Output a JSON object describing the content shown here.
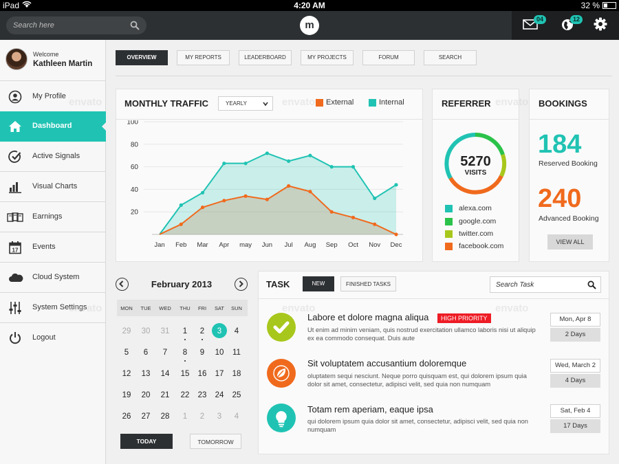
{
  "status_bar": {
    "device": "iPad",
    "time": "4:20 AM",
    "battery": "32 %"
  },
  "top_bar": {
    "search_placeholder": "Search here",
    "logo_letter": "m",
    "mail_badge": "04",
    "globe_badge": "12"
  },
  "sidebar": {
    "welcome": "Welcome",
    "user_name": "Kathleen Martin",
    "items": [
      {
        "label": "My Profile",
        "icon": "user-icon"
      },
      {
        "label": "Dashboard",
        "icon": "home-icon",
        "active": true
      },
      {
        "label": "Active Signals",
        "icon": "check-circle-icon"
      },
      {
        "label": "Visual Charts",
        "icon": "bar-chart-icon"
      },
      {
        "label": "Earnings",
        "icon": "money-icon"
      },
      {
        "label": "Events",
        "icon": "calendar-icon"
      },
      {
        "label": "Cloud System",
        "icon": "cloud-icon"
      },
      {
        "label": "System Settings",
        "icon": "sliders-icon"
      },
      {
        "label": "Logout",
        "icon": "power-icon"
      }
    ]
  },
  "tabs": [
    "OVERVIEW",
    "MY REPORTS",
    "LEADERBOARD",
    "MY PROJECTS",
    "FORUM",
    "SEARCH"
  ],
  "traffic": {
    "title": "MONTHLY TRAFFIC",
    "period": "YEARLY",
    "legend": {
      "external": "External",
      "internal": "Internal"
    }
  },
  "chart_data": {
    "type": "area",
    "title": "MONTHLY TRAFFIC",
    "categories": [
      "Jan",
      "Feb",
      "Mar",
      "Apr",
      "may",
      "Jun",
      "Jul",
      "Aug",
      "Sep",
      "Oct",
      "Nov",
      "Dec"
    ],
    "series": [
      {
        "name": "Internal",
        "color": "#20c3b3",
        "values": [
          0,
          26,
          37,
          63,
          63,
          72,
          65,
          70,
          60,
          60,
          32,
          44
        ]
      },
      {
        "name": "External",
        "color": "#f06a1d",
        "values": [
          0,
          9,
          24,
          30,
          34,
          31,
          43,
          38,
          20,
          15,
          9,
          0
        ]
      }
    ],
    "yticks": [
      "100",
      "80",
      "60",
      "40",
      "20"
    ],
    "ylim": [
      0,
      100
    ],
    "grid": true
  },
  "referrer": {
    "title": "REFERRER",
    "visits": "5270",
    "visits_label": "VISITS",
    "items": [
      {
        "label": "alexa.com",
        "color": "#20c3b3"
      },
      {
        "label": "google.com",
        "color": "#2bc24a"
      },
      {
        "label": "twitter.com",
        "color": "#a8c71c"
      },
      {
        "label": "facebook.com",
        "color": "#f06a1d"
      }
    ]
  },
  "bookings": {
    "title": "BOOKINGS",
    "reserved_value": "184",
    "reserved_label": "Reserved Booking",
    "advanced_value": "240",
    "advanced_label": "Advanced Booking",
    "view_all": "VIEW ALL"
  },
  "calendar": {
    "month": "February 2013",
    "dow": [
      "MON",
      "TUE",
      "WED",
      "THU",
      "FRI",
      "SAT",
      "SUN"
    ],
    "weeks": [
      [
        "29",
        "30",
        "31",
        "1",
        "2",
        "3",
        "4"
      ],
      [
        "5",
        "6",
        "7",
        "8",
        "9",
        "10",
        "11"
      ],
      [
        "12",
        "13",
        "14",
        "15",
        "16",
        "17",
        "18"
      ],
      [
        "19",
        "20",
        "21",
        "22",
        "23",
        "24",
        "25"
      ],
      [
        "26",
        "27",
        "28",
        "1",
        "2",
        "3",
        "4"
      ]
    ],
    "today": "TODAY",
    "tomorrow": "TOMORROW"
  },
  "task": {
    "title": "TASK",
    "tab_new": "NEW",
    "tab_finished": "FINISHED TASKS",
    "search_placeholder": "Search Task",
    "items": [
      {
        "title": "Labore et dolore magna aliqua",
        "priority": "HIGH PRIORITY",
        "desc": "Ut enim ad minim veniam, quis nostrud exercitation ullamco laboris nisi ut aliquip ex ea commodo consequat. Duis aute",
        "date": "Mon, Apr 8",
        "days": "2 Days",
        "icon": "check-icon",
        "color": "#a8c71c"
      },
      {
        "title": "Sit voluptatem accusantium doloremque",
        "priority": "",
        "desc": "oluptatem sequi nesciunt. Neque porro quisquam est, qui dolorem ipsum quia dolor sit amet, consectetur, adipisci velit, sed quia non numquam",
        "date": "Wed, March 2",
        "days": "4 Days",
        "icon": "leaf-icon",
        "color": "#f06a1d"
      },
      {
        "title": "Totam rem aperiam, eaque ipsa",
        "priority": "",
        "desc": "qui dolorem ipsum quia dolor sit amet, consectetur, adipisci velit, sed quia non numquam",
        "date": "Sat, Feb 4",
        "days": "17 Days",
        "icon": "bulb-icon",
        "color": "#20c3b3"
      }
    ]
  },
  "watermark": "envato"
}
